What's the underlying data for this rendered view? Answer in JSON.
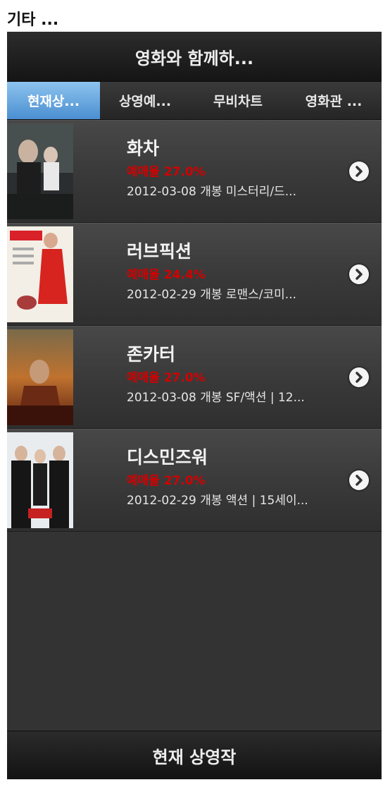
{
  "page_label": "기타 ...",
  "header": {
    "title": "영화와 함께하..."
  },
  "tabs": [
    {
      "label": "현재상...",
      "active": true
    },
    {
      "label": "상영예..."
    },
    {
      "label": "무비차트"
    },
    {
      "label": "영화관 ..."
    }
  ],
  "movies": [
    {
      "title": "화차",
      "rate": "예매율 27.0%",
      "info": "2012-03-08 개봉 미스터리/드...",
      "poster_icon": "movie-poster"
    },
    {
      "title": "러브픽션",
      "rate": "예매율 24.4%",
      "info": "2012-02-29 개봉 로맨스/코미...",
      "poster_icon": "movie-poster"
    },
    {
      "title": "존카터",
      "rate": "예매율 27.0%",
      "info": "2012-03-08 개봉 SF/액션 | 12...",
      "poster_icon": "movie-poster"
    },
    {
      "title": "디스민즈워",
      "rate": "예매율 27.0%",
      "info": "2012-02-29 개봉 액션 | 15세이...",
      "poster_icon": "movie-poster"
    }
  ],
  "footer": {
    "label": "현재 상영작"
  },
  "colors": {
    "active_tab": "#5b9fde",
    "rate": "#d40000",
    "background": "#333333"
  }
}
